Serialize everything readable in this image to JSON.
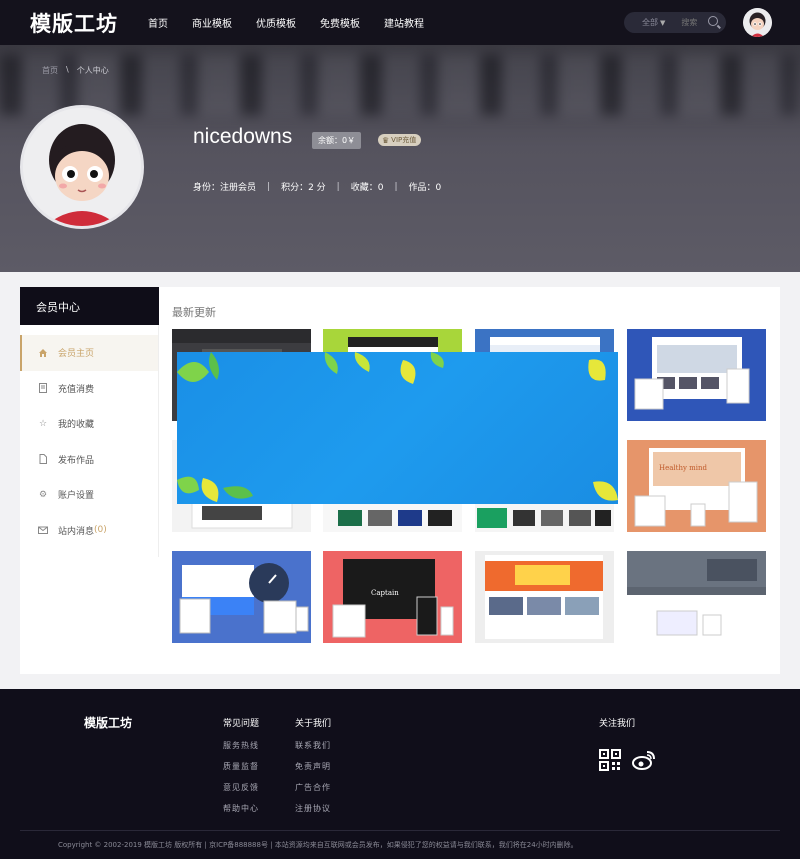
{
  "header": {
    "logo": "模版工坊",
    "nav": [
      "首页",
      "商业模板",
      "优质模板",
      "免费模板",
      "建站教程"
    ],
    "search_scope": "全部",
    "search_placeholder": "搜索"
  },
  "banner": {
    "breadcrumb_home": "首页",
    "breadcrumb_sep": "\\",
    "breadcrumb_current": "个人中心",
    "username": "nicedowns",
    "balance": "余额：0￥",
    "vip_label": "VIP充值",
    "stats": [
      "身份：注册会员",
      "积分：2 分",
      "收藏：0",
      "作品：0"
    ]
  },
  "member": {
    "title": "会员中心",
    "menu": [
      {
        "label": "会员主页",
        "icon": "home-icon"
      },
      {
        "label": "充值消费",
        "icon": "receipt-icon"
      },
      {
        "label": "我的收藏",
        "icon": "star-icon"
      },
      {
        "label": "发布作品",
        "icon": "file-icon"
      },
      {
        "label": "账户设置",
        "icon": "gear-icon"
      },
      {
        "label": "站内消息",
        "icon": "mail-icon",
        "count": "(0)"
      }
    ],
    "latest_title": "最新更新"
  },
  "footer": {
    "logo": "模版工坊",
    "col1_title": "常见问题",
    "col1_links": [
      "服务热线",
      "质量监督",
      "意见反馈",
      "帮助中心"
    ],
    "col2_title": "关于我们",
    "col2_links": [
      "联系我们",
      "免责声明",
      "广告合作",
      "注册协议"
    ],
    "follow_title": "关注我们",
    "copyright": "Copyright © 2002-2019 模版工坊 版权所有 | 京ICP备888888号 | 本站资源均来自互联网或会员发布，如果侵犯了您的权益请与我们联系，我们将在24小时内删除。"
  },
  "colors": {
    "accent": "#c9a46a",
    "header_bg": "#14121c",
    "footer_bg": "#100e1a",
    "promo_blue": "#1e9bee"
  }
}
